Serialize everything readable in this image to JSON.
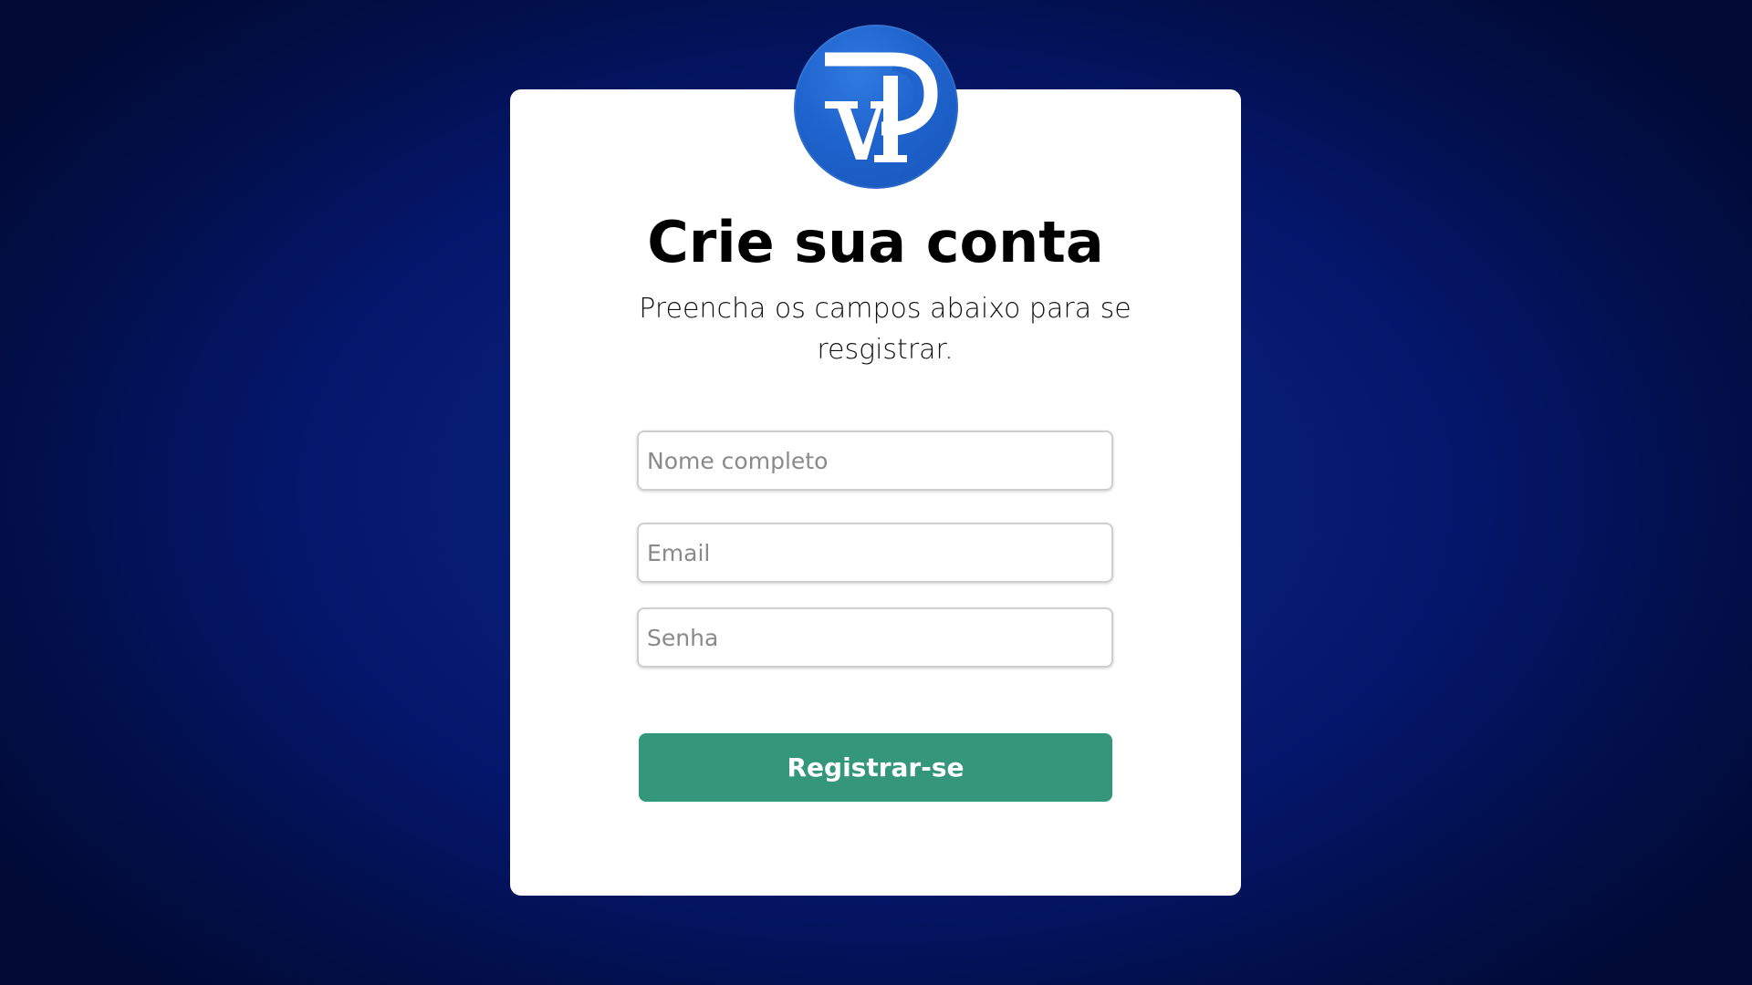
{
  "logo": {
    "icon": "pvi-logo-icon",
    "text": "PVI",
    "color": "#1f63cc"
  },
  "form": {
    "title": "Crie sua conta",
    "subtitle": "Preencha os campos abaixo para se resgistrar.",
    "fields": [
      {
        "placeholder": "Nome completo",
        "value": ""
      },
      {
        "placeholder": "Email",
        "value": ""
      },
      {
        "placeholder": "Senha",
        "value": ""
      }
    ],
    "submit_label": "Registrar-se"
  },
  "colors": {
    "background": "#061c72",
    "card": "#ffffff",
    "button": "#34967a"
  }
}
